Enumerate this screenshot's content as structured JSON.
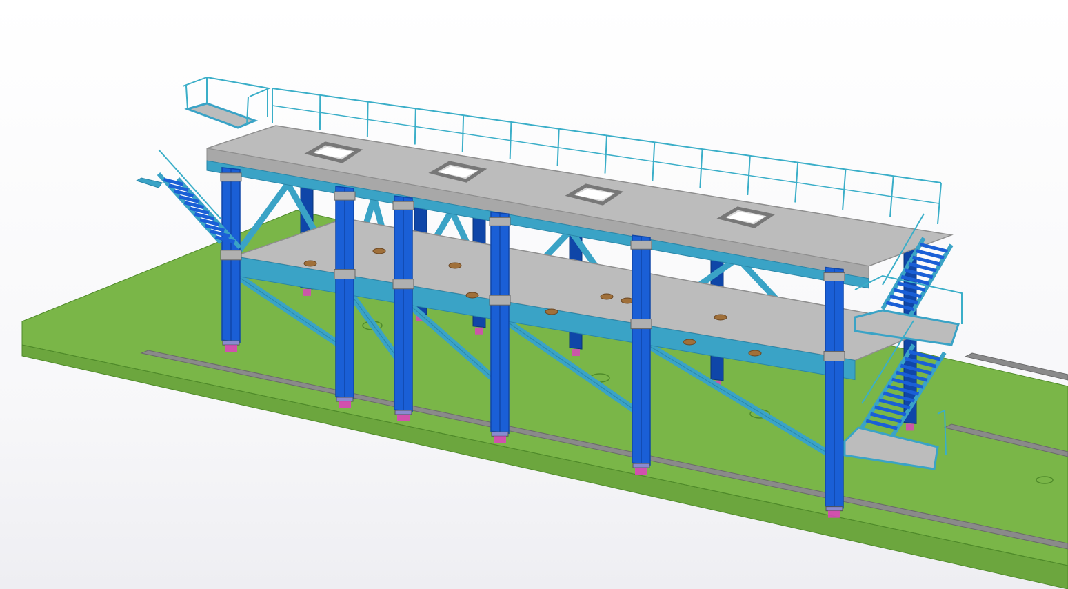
{
  "viewport": {
    "background": "#f7f7f9"
  },
  "model": {
    "colors": {
      "ground": "#7ab648",
      "ground_edge": "#4f8a2a",
      "ground_side": "#6ca63e",
      "rail": "#8a8a8a",
      "column": "#1a5fd6",
      "column_dark": "#0f46a8",
      "beam": "#3aa3c6",
      "beam_dark": "#2a86a8",
      "deck": "#bcbcbc",
      "deck_edge": "#8e8e8e",
      "railing": "#3aaec8",
      "anchor": "#e040c0",
      "bolt": "#a0703a"
    },
    "bays": 5,
    "levels": 2,
    "stairs": 3,
    "deck_openings": 4
  }
}
